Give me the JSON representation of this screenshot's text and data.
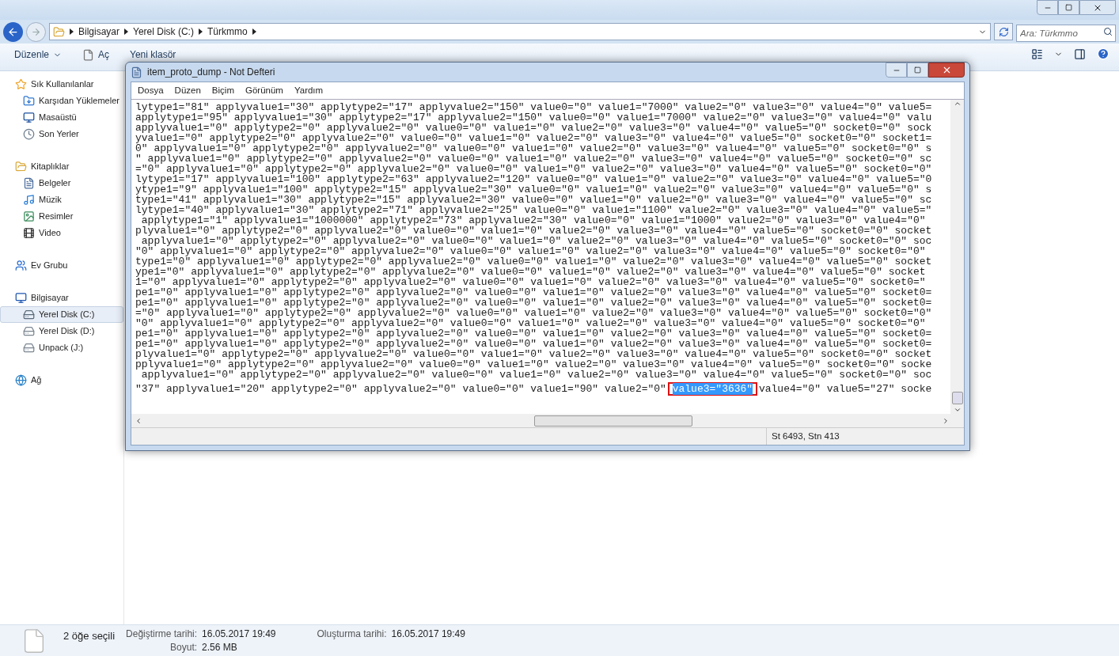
{
  "explorer": {
    "breadcrumb": [
      "Bilgisayar",
      "Yerel Disk (C:)",
      "Türkmmo"
    ],
    "search": {
      "placeholder": "Ara: Türkmmo"
    },
    "toolbar": [
      {
        "label": "Düzenle",
        "kind": "menu"
      },
      {
        "label": "Aç",
        "kind": "open"
      },
      {
        "label": "Yeni klasör",
        "kind": "plain"
      }
    ],
    "sidebar": [
      {
        "label": "Sık Kullanılanlar",
        "kind": "star",
        "selected": false,
        "children": [
          {
            "label": "Karşıdan Yüklemeler",
            "kind": "download",
            "selected": false
          },
          {
            "label": "Masaüstü",
            "kind": "desktop",
            "selected": false
          },
          {
            "label": "Son Yerler",
            "kind": "recent",
            "selected": false
          }
        ]
      },
      {
        "label": "Kitaplıklar",
        "kind": "library",
        "selected": false,
        "children": [
          {
            "label": "Belgeler",
            "kind": "document",
            "selected": false
          },
          {
            "label": "Müzik",
            "kind": "music",
            "selected": false
          },
          {
            "label": "Resimler",
            "kind": "image",
            "selected": false
          },
          {
            "label": "Video",
            "kind": "video",
            "selected": false
          }
        ]
      },
      {
        "label": "Ev Grubu",
        "kind": "homegroup",
        "selected": false
      },
      {
        "label": "Bilgisayar",
        "kind": "computer",
        "selected": false,
        "children": [
          {
            "label": "Yerel Disk (C:)",
            "kind": "systemdisk",
            "selected": true
          },
          {
            "label": "Yerel Disk (D:)",
            "kind": "disk",
            "selected": false
          },
          {
            "label": "Unpack (J:)",
            "kind": "disk",
            "selected": false
          }
        ]
      },
      {
        "label": "Ağ",
        "kind": "network",
        "selected": false
      }
    ],
    "details": {
      "summary": "2 öğe seçili",
      "fields": [
        {
          "label": "Değiştirme tarihi:",
          "value": "16.05.2017 19:49"
        },
        {
          "label": "Oluşturma tarihi:",
          "value": "16.05.2017 19:49"
        },
        {
          "label": "Boyut:",
          "value": "2.56 MB"
        }
      ]
    }
  },
  "notepad": {
    "title": "item_proto_dump - Not Defteri",
    "menu": [
      "Dosya",
      "Düzen",
      "Biçim",
      "Görünüm",
      "Yardım"
    ],
    "lines": [
      "lytype1=\"81\" applyvalue1=\"30\" applytype2=\"17\" applyvalue2=\"150\" value0=\"0\" value1=\"7000\" value2=\"0\" value3=\"0\" value4=\"0\" value5=",
      "applytype1=\"95\" applyvalue1=\"30\" applytype2=\"17\" applyvalue2=\"150\" value0=\"0\" value1=\"7000\" value2=\"0\" value3=\"0\" value4=\"0\" valu",
      "applyvalue1=\"0\" applytype2=\"0\" applyvalue2=\"0\" value0=\"0\" value1=\"0\" value2=\"0\" value3=\"0\" value4=\"0\" value5=\"0\" socket0=\"0\" sock",
      "yvalue1=\"0\" applytype2=\"0\" applyvalue2=\"0\" value0=\"0\" value1=\"0\" value2=\"0\" value3=\"0\" value4=\"0\" value5=\"0\" socket0=\"0\" socket1=",
      "0\" applyvalue1=\"0\" applytype2=\"0\" applyvalue2=\"0\" value0=\"0\" value1=\"0\" value2=\"0\" value3=\"0\" value4=\"0\" value5=\"0\" socket0=\"0\" s",
      "\" applyvalue1=\"0\" applytype2=\"0\" applyvalue2=\"0\" value0=\"0\" value1=\"0\" value2=\"0\" value3=\"0\" value4=\"0\" value5=\"0\" socket0=\"0\" sc",
      "=\"0\" applyvalue1=\"0\" applytype2=\"0\" applyvalue2=\"0\" value0=\"0\" value1=\"0\" value2=\"0\" value3=\"0\" value4=\"0\" value5=\"0\" socket0=\"0\"",
      "lytype1=\"17\" applyvalue1=\"100\" applytype2=\"63\" applyvalue2=\"120\" value0=\"0\" value1=\"0\" value2=\"0\" value3=\"0\" value4=\"0\" value5=\"0",
      "ytype1=\"9\" applyvalue1=\"100\" applytype2=\"15\" applyvalue2=\"30\" value0=\"0\" value1=\"0\" value2=\"0\" value3=\"0\" value4=\"0\" value5=\"0\" s",
      "type1=\"41\" applyvalue1=\"30\" applytype2=\"15\" applyvalue2=\"30\" value0=\"0\" value1=\"0\" value2=\"0\" value3=\"0\" value4=\"0\" value5=\"0\" sc",
      "lytype1=\"40\" applyvalue1=\"30\" applytype2=\"71\" applyvalue2=\"25\" value0=\"0\" value1=\"1100\" value2=\"0\" value3=\"0\" value4=\"0\" value5=\"",
      " applytype1=\"1\" applyvalue1=\"1000000\" applytype2=\"73\" applyvalue2=\"30\" value0=\"0\" value1=\"1000\" value2=\"0\" value3=\"0\" value4=\"0\"",
      "plyvalue1=\"0\" applytype2=\"0\" applyvalue2=\"0\" value0=\"0\" value1=\"0\" value2=\"0\" value3=\"0\" value4=\"0\" value5=\"0\" socket0=\"0\" socket",
      " applyvalue1=\"0\" applytype2=\"0\" applyvalue2=\"0\" value0=\"0\" value1=\"0\" value2=\"0\" value3=\"0\" value4=\"0\" value5=\"0\" socket0=\"0\" soc",
      "\"0\" applyvalue1=\"0\" applytype2=\"0\" applyvalue2=\"0\" value0=\"0\" value1=\"0\" value2=\"0\" value3=\"0\" value4=\"0\" value5=\"0\" socket0=\"0\"",
      "type1=\"0\" applyvalue1=\"0\" applytype2=\"0\" applyvalue2=\"0\" value0=\"0\" value1=\"0\" value2=\"0\" value3=\"0\" value4=\"0\" value5=\"0\" socket",
      "ype1=\"0\" applyvalue1=\"0\" applytype2=\"0\" applyvalue2=\"0\" value0=\"0\" value1=\"0\" value2=\"0\" value3=\"0\" value4=\"0\" value5=\"0\" socket",
      "1=\"0\" applyvalue1=\"0\" applytype2=\"0\" applyvalue2=\"0\" value0=\"0\" value1=\"0\" value2=\"0\" value3=\"0\" value4=\"0\" value5=\"0\" socket0=\"",
      "pe1=\"0\" applyvalue1=\"0\" applytype2=\"0\" applyvalue2=\"0\" value0=\"0\" value1=\"0\" value2=\"0\" value3=\"0\" value4=\"0\" value5=\"0\" socket0=",
      "pe1=\"0\" applyvalue1=\"0\" applytype2=\"0\" applyvalue2=\"0\" value0=\"0\" value1=\"0\" value2=\"0\" value3=\"0\" value4=\"0\" value5=\"0\" socket0=",
      "=\"0\" applyvalue1=\"0\" applytype2=\"0\" applyvalue2=\"0\" value0=\"0\" value1=\"0\" value2=\"0\" value3=\"0\" value4=\"0\" value5=\"0\" socket0=\"0\"",
      "\"0\" applyvalue1=\"0\" applytype2=\"0\" applyvalue2=\"0\" value0=\"0\" value1=\"0\" value2=\"0\" value3=\"0\" value4=\"0\" value5=\"0\" socket0=\"0\"",
      "pe1=\"0\" applyvalue1=\"0\" applytype2=\"0\" applyvalue2=\"0\" value0=\"0\" value1=\"0\" value2=\"0\" value3=\"0\" value4=\"0\" value5=\"0\" socket0=",
      "pe1=\"0\" applyvalue1=\"0\" applytype2=\"0\" applyvalue2=\"0\" value0=\"0\" value1=\"0\" value2=\"0\" value3=\"0\" value4=\"0\" value5=\"0\" socket0=",
      "plyvalue1=\"0\" applytype2=\"0\" applyvalue2=\"0\" value0=\"0\" value1=\"0\" value2=\"0\" value3=\"0\" value4=\"0\" value5=\"0\" socket0=\"0\" socket",
      "pplyvalue1=\"0\" applytype2=\"0\" applyvalue2=\"0\" value0=\"0\" value1=\"0\" value2=\"0\" value3=\"0\" value4=\"0\" value5=\"0\" socket0=\"0\" socke",
      " applyvalue1=\"0\" applytype2=\"0\" applyvalue2=\"0\" value0=\"0\" value1=\"0\" value2=\"0\" value3=\"0\" value4=\"0\" value5=\"0\" socket0=\"0\" soc"
    ],
    "selection": {
      "before": "\"37\" applyvalue1=\"20\" applytype2=\"0\" applyvalue2=\"0\" value0=\"0\" value1=\"90\" value2=\"0\" ",
      "text": "value3=\"3636\"",
      "after": " value4=\"0\" value5=\"27\" socke",
      "outlined": true
    },
    "status": "St 6493, Stn 413"
  }
}
